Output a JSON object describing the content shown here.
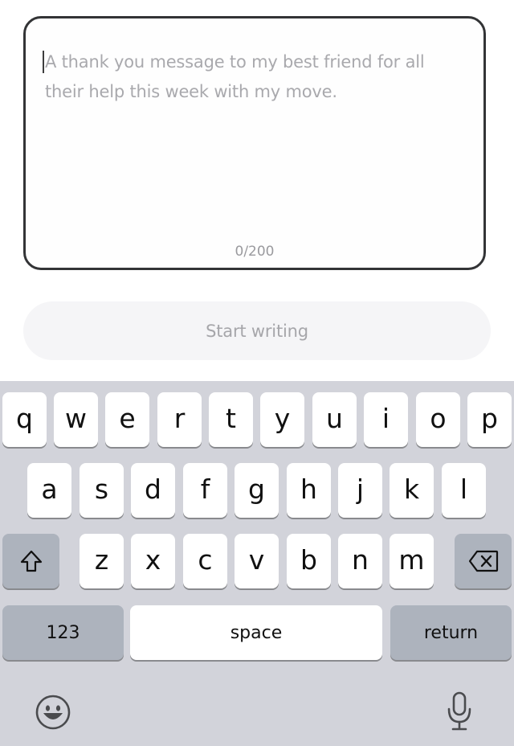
{
  "compose": {
    "placeholder": "A thank you message to my best friend for all their help this week with my move.",
    "counter": "0/200",
    "start_label": "Start writing"
  },
  "keyboard": {
    "row1": [
      "q",
      "w",
      "e",
      "r",
      "t",
      "y",
      "u",
      "i",
      "o",
      "p"
    ],
    "row2": [
      "a",
      "s",
      "d",
      "f",
      "g",
      "h",
      "j",
      "k",
      "l"
    ],
    "row3": [
      "z",
      "x",
      "c",
      "v",
      "b",
      "n",
      "m"
    ],
    "numbers_label": "123",
    "space_label": "space",
    "return_label": "return",
    "shift_icon": "shift-icon",
    "delete_icon": "backspace-icon",
    "emoji_icon": "emoji-icon",
    "mic_icon": "microphone-icon"
  }
}
